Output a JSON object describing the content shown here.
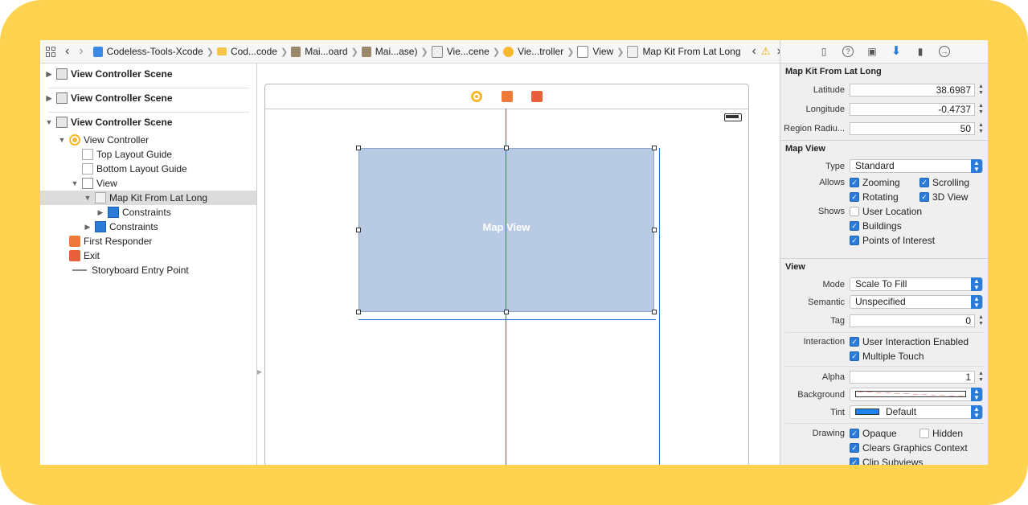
{
  "toolbar": {
    "breadcrumbs": [
      "Codeless-Tools-Xcode",
      "Cod...code",
      "Mai...oard",
      "Mai...ase)",
      "Vie...cene",
      "Vie...troller",
      "View",
      "Map Kit From Lat Long"
    ]
  },
  "outline": {
    "scene1": "View Controller Scene",
    "scene2": "View Controller Scene",
    "scene3": "View Controller Scene",
    "view_controller": "View Controller",
    "top_layout_guide": "Top Layout Guide",
    "bottom_layout_guide": "Bottom Layout Guide",
    "view": "View",
    "map_kit": "Map Kit From Lat Long",
    "map_constraints": "Constraints",
    "view_constraints": "Constraints",
    "first_responder": "First Responder",
    "exit": "Exit",
    "entry_point": "Storyboard Entry Point"
  },
  "canvas": {
    "map_view_label": "Map View"
  },
  "inspector": {
    "class_section_title": "Map Kit From Lat Long",
    "latitude_label": "Latitude",
    "latitude_value": "38.6987",
    "longitude_label": "Longitude",
    "longitude_value": "-0.4737",
    "radius_label": "Region Radiu...",
    "radius_value": "50",
    "map_section_title": "Map View",
    "type_label": "Type",
    "type_value": "Standard",
    "allows_label": "Allows",
    "zooming": "Zooming",
    "scrolling": "Scrolling",
    "rotating": "Rotating",
    "view_3d": "3D View",
    "shows_label": "Shows",
    "user_location": "User Location",
    "buildings": "Buildings",
    "points_of_interest": "Points of Interest",
    "view_section_title": "View",
    "mode_label": "Mode",
    "mode_value": "Scale To Fill",
    "semantic_label": "Semantic",
    "semantic_value": "Unspecified",
    "tag_label": "Tag",
    "tag_value": "0",
    "interaction_label": "Interaction",
    "user_interaction_enabled": "User Interaction Enabled",
    "multiple_touch": "Multiple Touch",
    "alpha_label": "Alpha",
    "alpha_value": "1",
    "background_label": "Background",
    "tint_label": "Tint",
    "tint_value": "Default",
    "drawing_label": "Drawing",
    "opaque": "Opaque",
    "hidden": "Hidden",
    "clears_graphics_context": "Clears Graphics Context",
    "clip_subviews": "Clip Subviews"
  },
  "colors": {
    "frame": "#ffd24f",
    "accent": "#2b7bd8",
    "map_fill": "#b9cbe4",
    "tint_swatch": "#1f84f0"
  }
}
